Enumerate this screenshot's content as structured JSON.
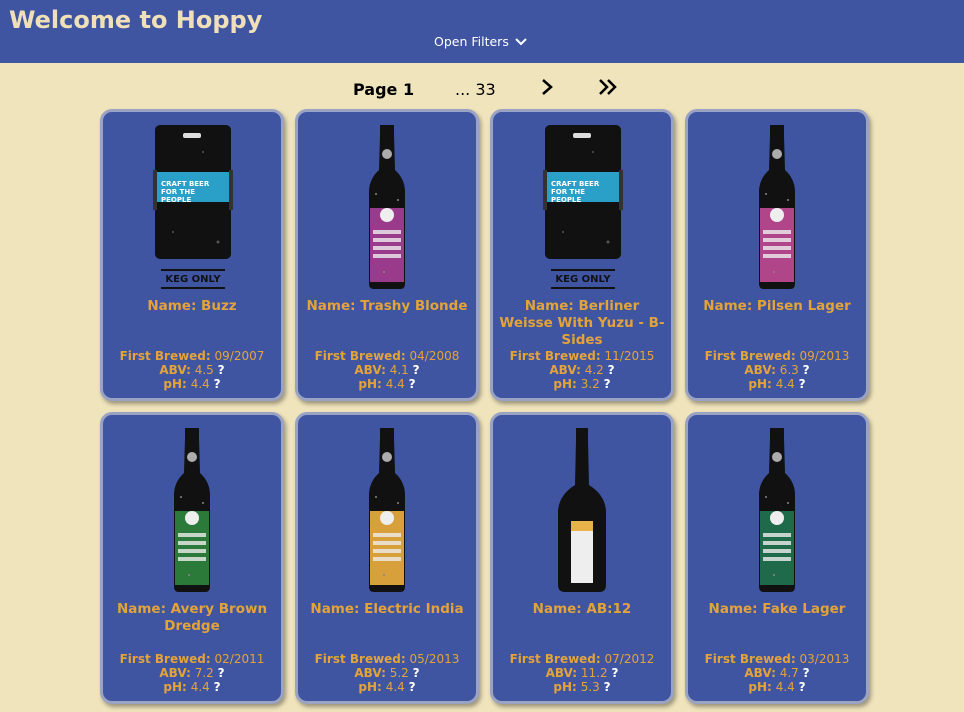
{
  "header": {
    "title": "Welcome to Hoppy",
    "filters_label": "Open Filters",
    "filters_icon": "chevron-down-icon"
  },
  "pagination": {
    "current_label": "Page 1",
    "last_label": "... 33",
    "next_icon": "chevron-right-icon",
    "last_icon": "double-chevron-right-icon"
  },
  "labels": {
    "first_brewed": "First Brewed:",
    "abv": "ABV:",
    "ph": "pH:",
    "help": "?"
  },
  "beers": [
    {
      "name": "Name: Buzz",
      "first_brewed": "09/2007",
      "abv": "4.5",
      "ph": "4.4",
      "image": "keg-icon",
      "label_color": "#2aa0c8"
    },
    {
      "name": "Name: Trashy Blonde",
      "first_brewed": "04/2008",
      "abv": "4.1",
      "ph": "4.4",
      "image": "bottle-icon",
      "label_color": "#9a3a8a"
    },
    {
      "name": "Name: Berliner Weisse With Yuzu - B-Sides",
      "first_brewed": "11/2015",
      "abv": "4.2",
      "ph": "3.2",
      "image": "keg-icon",
      "label_color": "#2aa0c8"
    },
    {
      "name": "Name: Pilsen Lager",
      "first_brewed": "09/2013",
      "abv": "6.3",
      "ph": "4.4",
      "image": "bottle-icon",
      "label_color": "#b0458a"
    },
    {
      "name": "Name: Avery Brown Dredge",
      "first_brewed": "02/2011",
      "abv": "7.2",
      "ph": "4.4",
      "image": "bottle-icon",
      "label_color": "#2c7a3a"
    },
    {
      "name": "Name: Electric India",
      "first_brewed": "05/2013",
      "abv": "5.2",
      "ph": "4.4",
      "image": "bottle-icon",
      "label_color": "#d8a03a"
    },
    {
      "name": "Name: AB:12",
      "first_brewed": "07/2012",
      "abv": "11.2",
      "ph": "5.3",
      "image": "tall-bottle-icon",
      "label_color": "#e8b24a"
    },
    {
      "name": "Name: Fake Lager",
      "first_brewed": "03/2013",
      "abv": "4.7",
      "ph": "4.4",
      "image": "bottle-icon",
      "label_color": "#1f6a4a"
    }
  ]
}
